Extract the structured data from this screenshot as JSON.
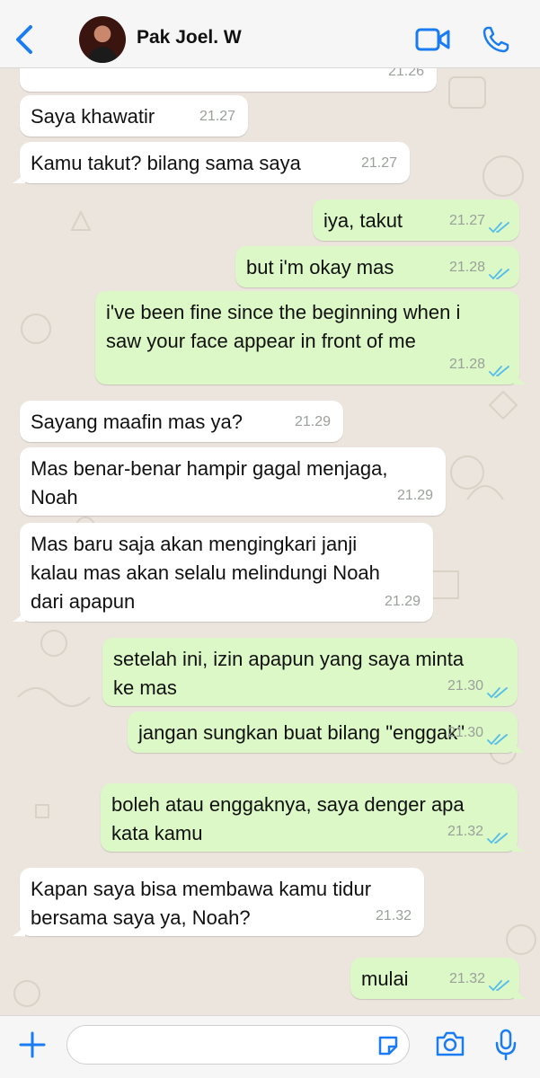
{
  "header": {
    "contact_name": "Pak Joel. W"
  },
  "colors": {
    "accent": "#1a7cf3",
    "incoming_bubble": "#ffffff",
    "outgoing_bubble": "#dcf8c6",
    "chat_background": "#ece5dd",
    "read_ticks": "#53bdeb"
  },
  "messages": [
    {
      "direction": "in",
      "text": "",
      "time": "21.26"
    },
    {
      "direction": "in",
      "text": "Saya khawatir",
      "time": "21.27"
    },
    {
      "direction": "in",
      "text": "Kamu takut? bilang sama saya",
      "time": "21.27"
    },
    {
      "direction": "out",
      "text": "iya, takut",
      "time": "21.27",
      "status": "read"
    },
    {
      "direction": "out",
      "text": "but i'm okay mas",
      "time": "21.28",
      "status": "read"
    },
    {
      "direction": "out",
      "text": "i've been fine since the beginning when i\nsaw your face appear in front of me",
      "time": "21.28",
      "status": "read"
    },
    {
      "direction": "in",
      "text": "Sayang maafin mas ya?",
      "time": "21.29"
    },
    {
      "direction": "in",
      "text": "Mas benar-benar hampir gagal menjaga,\nNoah",
      "time": "21.29"
    },
    {
      "direction": "in",
      "text": "Mas baru saja akan mengingkari janji\nkalau mas akan selalu melindungi Noah\ndari apapun",
      "time": "21.29"
    },
    {
      "direction": "out",
      "text": "setelah ini, izin apapun yang saya minta\nke mas",
      "time": "21.30",
      "status": "read"
    },
    {
      "direction": "out",
      "text": "jangan sungkan buat bilang \"enggak\"",
      "time": "21.30",
      "status": "read"
    },
    {
      "direction": "out",
      "text": "boleh atau enggaknya, saya denger apa\nkata kamu",
      "time": "21.32",
      "status": "read"
    },
    {
      "direction": "in",
      "text": "Kapan saya bisa membawa kamu tidur\nbersama saya ya, Noah?",
      "time": "21.32"
    },
    {
      "direction": "out",
      "text": "mulai",
      "time": "21.32",
      "status": "read"
    }
  ],
  "composer": {
    "value": "",
    "placeholder": ""
  },
  "icons": {
    "back": "chevron-left-icon",
    "video_call": "video-camera-icon",
    "voice_call": "phone-icon",
    "attach": "plus-icon",
    "sticker": "sticker-icon",
    "camera": "camera-icon",
    "microphone": "microphone-icon"
  }
}
